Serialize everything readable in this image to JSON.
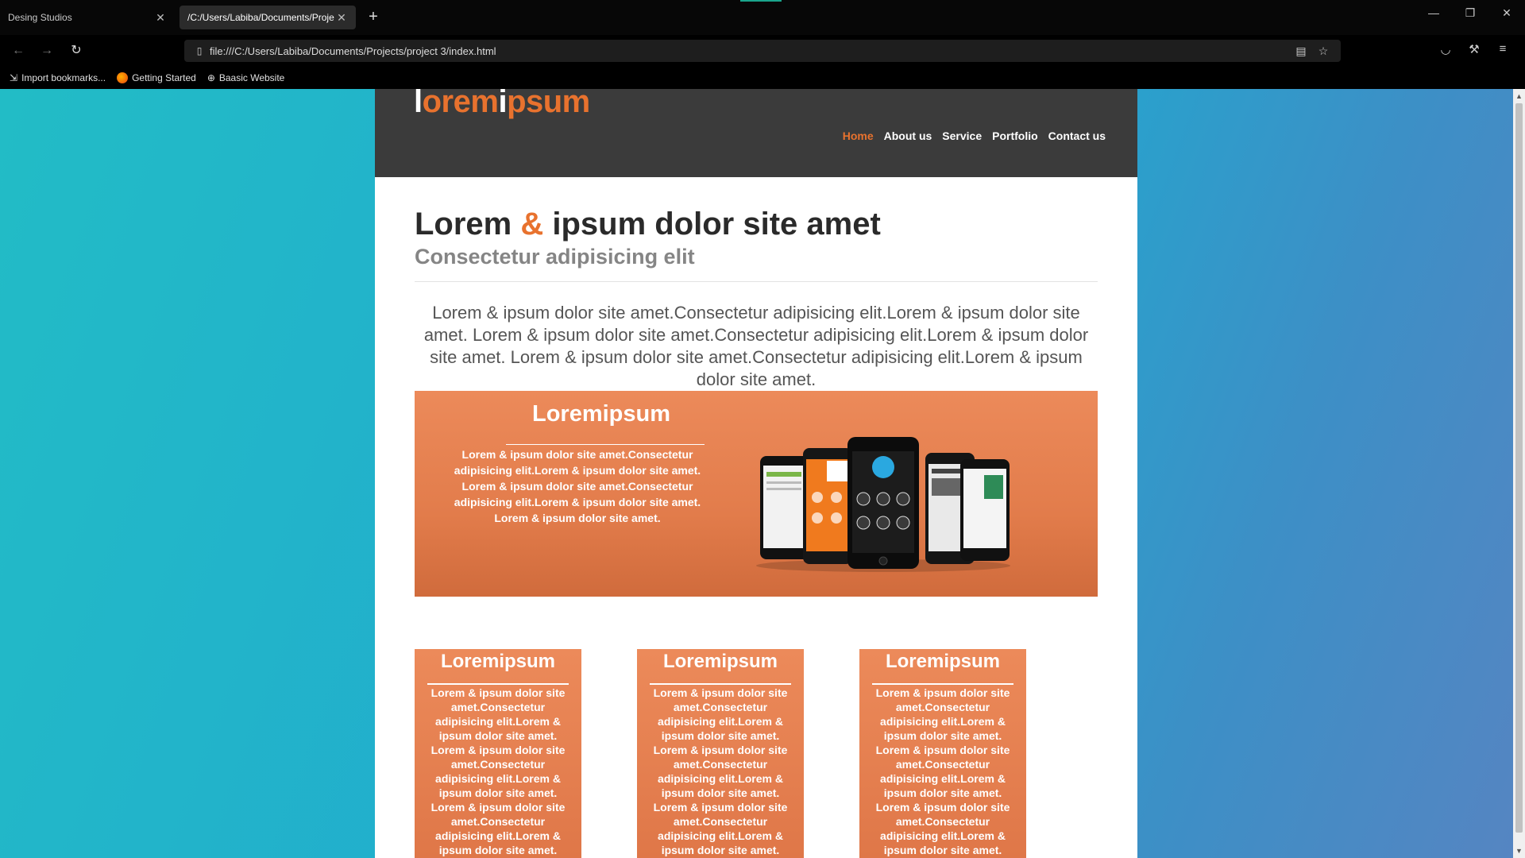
{
  "browser": {
    "tabs": [
      {
        "label": "Desing Studios",
        "active": false
      },
      {
        "label": "/C:/Users/Labiba/Documents/Proje",
        "active": true
      }
    ],
    "url": "file:///C:/Users/Labiba/Documents/Projects/project 3/index.html",
    "bookmarks": [
      {
        "label": "Import bookmarks...",
        "icon": "import-icon"
      },
      {
        "label": "Getting Started",
        "icon": "firefox-icon"
      },
      {
        "label": "Baasic Website",
        "icon": "globe-icon"
      }
    ]
  },
  "site": {
    "logo": {
      "part1": "l",
      "part2": "orem",
      "part3": "i",
      "part4": "psum"
    },
    "nav": [
      {
        "label": "Home",
        "active": true
      },
      {
        "label": "About us",
        "active": false
      },
      {
        "label": "Service",
        "active": false
      },
      {
        "label": "Portfolio",
        "active": false
      },
      {
        "label": "Contact us",
        "active": false
      }
    ],
    "hero": {
      "title_a": "Lorem ",
      "title_amp": "&",
      "title_b": " ipsum dolor site amet",
      "subtitle": "Consectetur adipisicing elit"
    },
    "intro": "Lorem & ipsum dolor site amet.Consectetur adipisicing elit.Lorem & ipsum dolor site amet. Lorem & ipsum dolor site amet.Consectetur adipisicing elit.Lorem & ipsum dolor site amet. Lorem & ipsum dolor site amet.Consectetur adipisicing elit.Lorem & ipsum dolor site amet.",
    "banner": {
      "title": "Loremipsum",
      "text": "Lorem & ipsum dolor site amet.Consectetur adipisicing elit.Lorem & ipsum dolor site amet. Lorem & ipsum dolor site amet.Consectetur adipisicing elit.Lorem & ipsum dolor site amet. Lorem & ipsum dolor site amet."
    },
    "boxes": [
      {
        "title": "Loremipsum",
        "text": "Lorem & ipsum dolor site amet.Consectetur adipisicing elit.Lorem & ipsum dolor site amet. Lorem & ipsum dolor site amet.Consectetur adipisicing elit.Lorem & ipsum dolor site amet. Lorem & ipsum dolor site amet.Consectetur adipisicing elit.Lorem & ipsum dolor site amet."
      },
      {
        "title": "Loremipsum",
        "text": "Lorem & ipsum dolor site amet.Consectetur adipisicing elit.Lorem & ipsum dolor site amet. Lorem & ipsum dolor site amet.Consectetur adipisicing elit.Lorem & ipsum dolor site amet. Lorem & ipsum dolor site amet.Consectetur adipisicing elit.Lorem & ipsum dolor site amet."
      },
      {
        "title": "Loremipsum",
        "text": "Lorem & ipsum dolor site amet.Consectetur adipisicing elit.Lorem & ipsum dolor site amet. Lorem & ipsum dolor site amet.Consectetur adipisicing elit.Lorem & ipsum dolor site amet. Lorem & ipsum dolor site amet.Consectetur adipisicing elit.Lorem & ipsum dolor site amet."
      }
    ]
  },
  "colors": {
    "accent": "#e8722e",
    "header_bg": "#3b3b3b",
    "box_bg": "#e57f4e"
  }
}
